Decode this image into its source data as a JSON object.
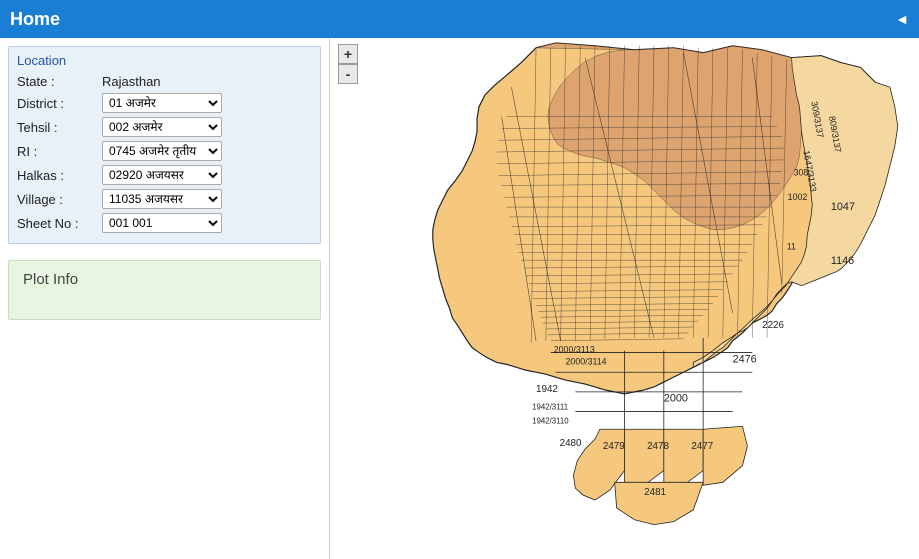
{
  "header": {
    "title": "Home",
    "arrow": "◄"
  },
  "sidebar": {
    "location_label": "Location",
    "state_label": "State :",
    "state_value": "Rajasthan",
    "district_label": "District :",
    "district_value": "01 अजमेर",
    "tehsil_label": "Tehsil :",
    "tehsil_value": "002 अजमेर",
    "ri_label": "RI :",
    "ri_value": "0745 अजमेर तृतीय",
    "halkas_label": "Halkas :",
    "halkas_value": "02920 अजयसर",
    "village_label": "Village :",
    "village_value": "11035 अजयसर",
    "sheet_label": "Sheet No :",
    "sheet_value": "001 001"
  },
  "plot_info": {
    "label": "Plot Info"
  },
  "map_controls": {
    "zoom_in": "+",
    "zoom_out": "-"
  }
}
